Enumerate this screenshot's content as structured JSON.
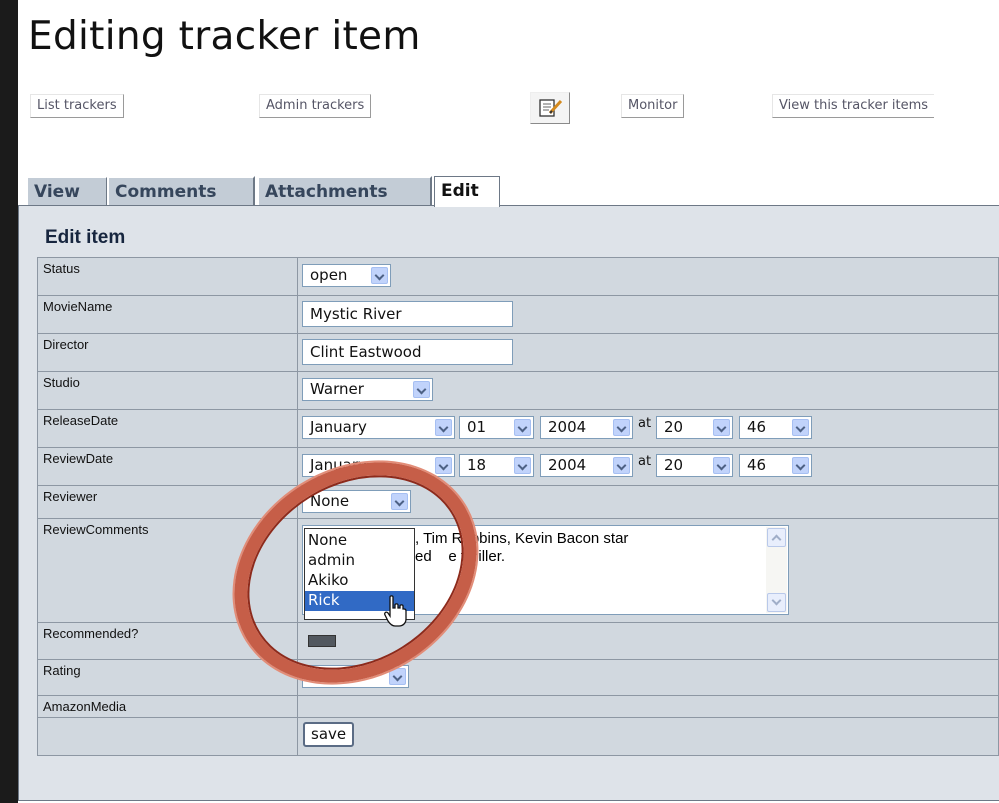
{
  "page": {
    "title": "Editing tracker item",
    "nav_buttons": [
      "List trackers",
      "Admin trackers",
      "Monitor",
      "View this tracker items"
    ],
    "edit_icon": "edit-notepad-icon",
    "tabs": [
      "View",
      "Comments",
      "Attachments",
      "Edit"
    ],
    "active_tab": "Edit"
  },
  "form": {
    "heading": "Edit item",
    "labels": {
      "status": "Status",
      "moviename": "MovieName",
      "director": "Director",
      "studio": "Studio",
      "releasedate": "ReleaseDate",
      "reviewdate": "ReviewDate",
      "reviewer": "Reviewer",
      "reviewcomments": "ReviewComments",
      "recommended": "Recommended?",
      "rating": "Rating",
      "amazonmedia": "AmazonMedia"
    },
    "status_value": "open",
    "moviename_value": "Mystic River",
    "director_value": "Clint Eastwood",
    "studio_value": "Warner",
    "release": {
      "month": "January",
      "day": "01",
      "year": "2004",
      "at": "at",
      "hour": "20",
      "minute": "46"
    },
    "review": {
      "month": "January",
      "day": "18",
      "year": "2004",
      "at": "at",
      "hour": "20",
      "minute": "46"
    },
    "reviewer_value": "None",
    "reviewer_options": [
      "None",
      "admin",
      "Akiko",
      "Rick"
    ],
    "reviewer_highlighted": "Rick",
    "comments_line1": ", Tim Robbins, Kevin Bacon star",
    "comments_line2": "ed    e thriller.",
    "rating_value": "*****",
    "save_label": "save"
  },
  "colors": {
    "tab_inactive": "#c3ccd6",
    "panel": "#dee3e9",
    "row": "#d1d8df",
    "highlight_ring": "#c65e48",
    "selected_option": "#316ac5"
  }
}
